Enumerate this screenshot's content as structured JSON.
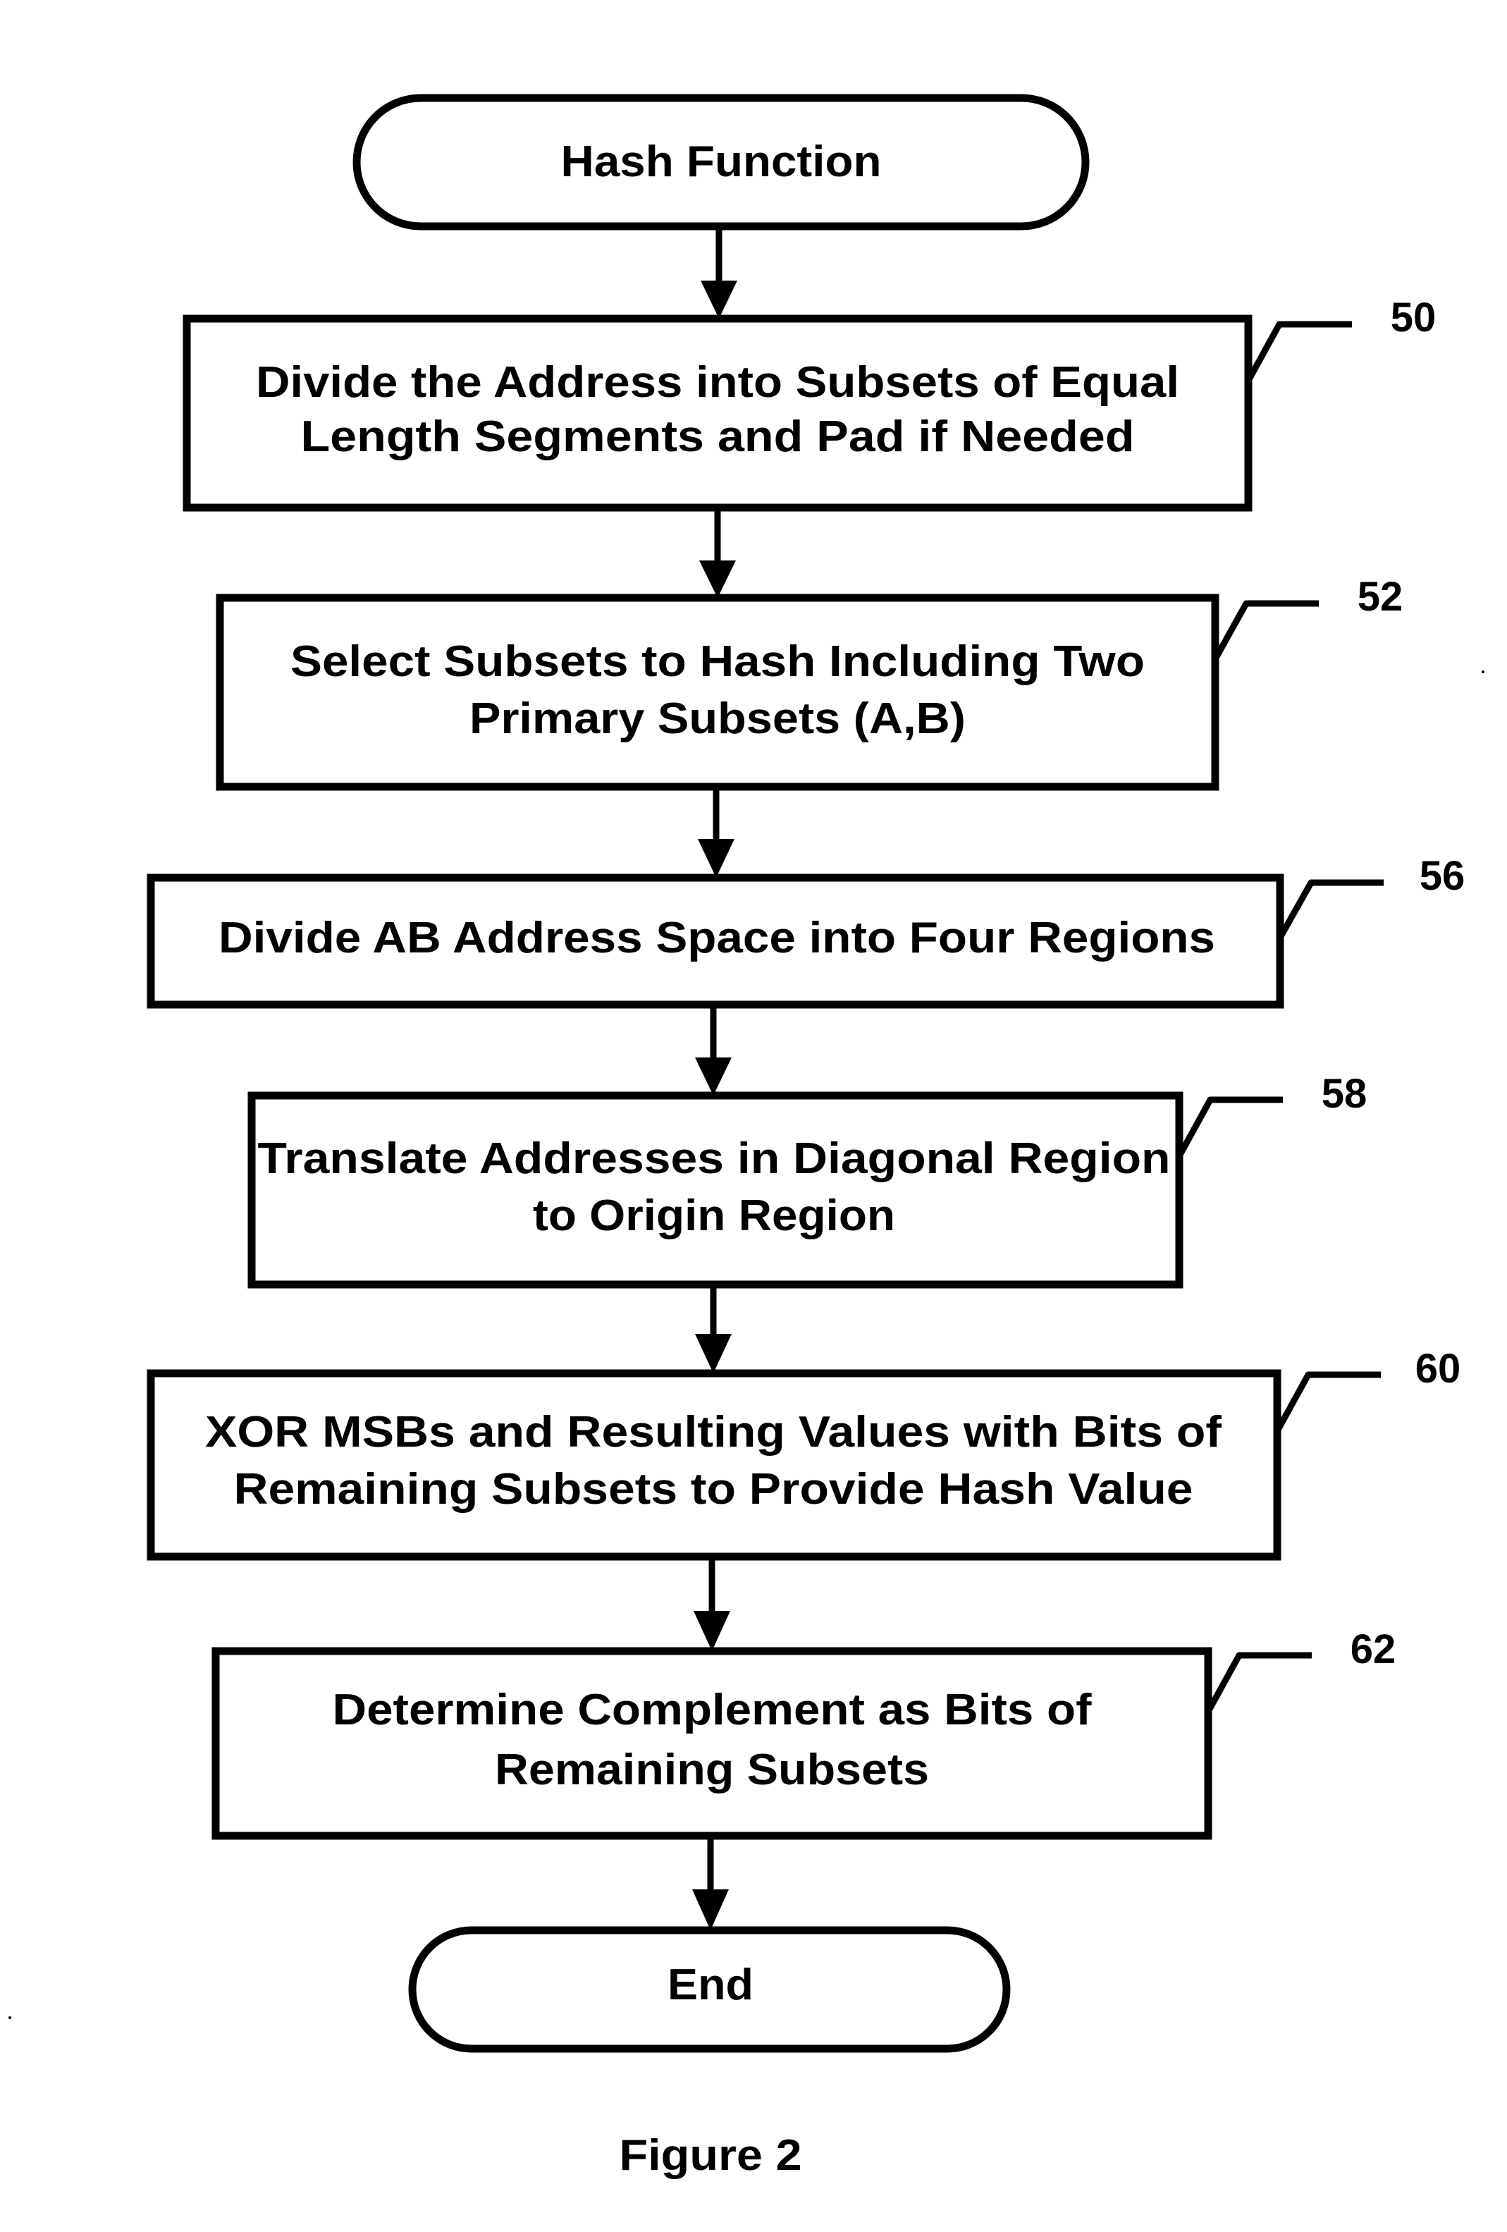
{
  "diagram": {
    "type": "flowchart",
    "caption": "Figure 2",
    "start": {
      "label": "Hash Function"
    },
    "steps": [
      {
        "ref": "50",
        "lines": [
          "Divide the Address into Subsets of Equal",
          "Length Segments and Pad if Needed"
        ]
      },
      {
        "ref": "52",
        "lines": [
          "Select Subsets to Hash Including Two",
          "Primary Subsets (A,B)"
        ]
      },
      {
        "ref": "56",
        "lines": [
          "Divide AB Address Space into Four Regions"
        ]
      },
      {
        "ref": "58",
        "lines": [
          "Translate Addresses in Diagonal Region",
          "to Origin Region"
        ]
      },
      {
        "ref": "60",
        "lines": [
          "XOR MSBs and Resulting Values with Bits of",
          "Remaining Subsets to Provide Hash Value"
        ]
      },
      {
        "ref": "62",
        "lines": [
          "Determine Complement as Bits of",
          "Remaining Subsets"
        ]
      }
    ],
    "end": {
      "label": "End"
    },
    "edges": [
      {
        "from": "Hash Function",
        "to": "50"
      },
      {
        "from": "50",
        "to": "52"
      },
      {
        "from": "52",
        "to": "56"
      },
      {
        "from": "56",
        "to": "58"
      },
      {
        "from": "58",
        "to": "60"
      },
      {
        "from": "60",
        "to": "62"
      },
      {
        "from": "62",
        "to": "End"
      }
    ],
    "colors": {
      "stroke": "#000000",
      "background": "#ffffff"
    }
  }
}
